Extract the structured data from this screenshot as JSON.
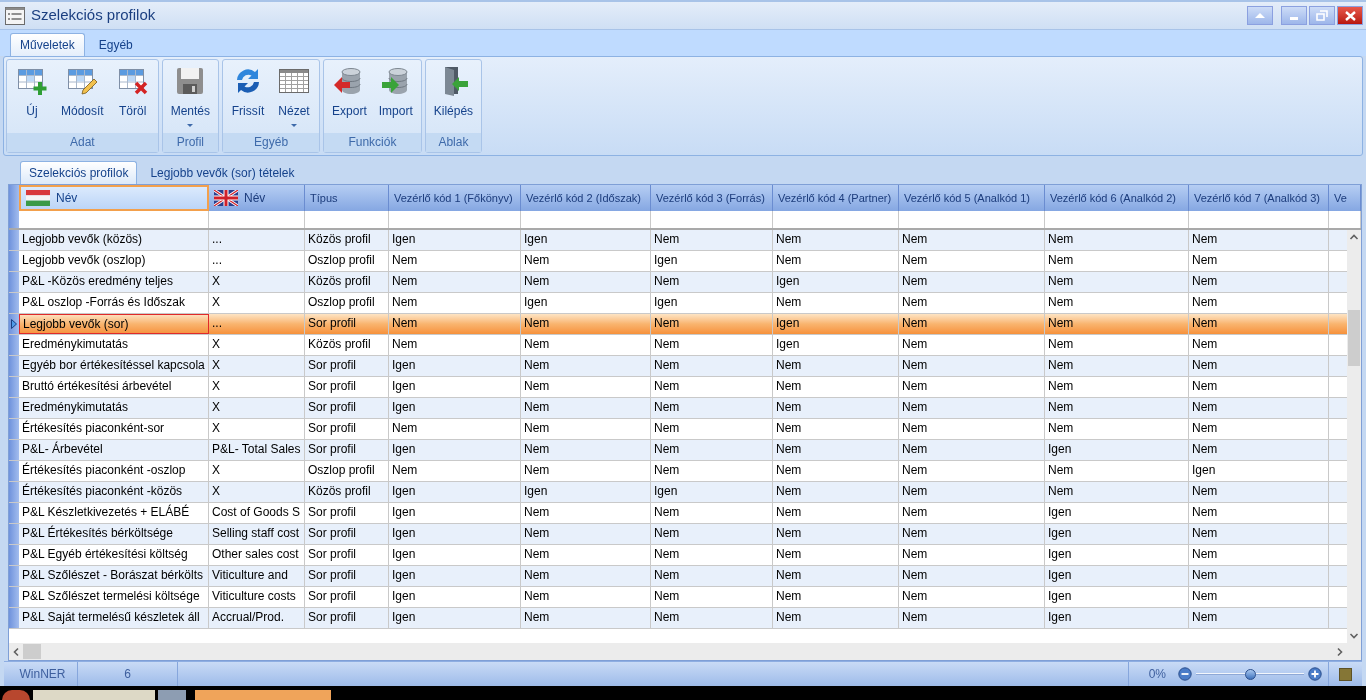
{
  "window": {
    "title": "Szelekciós profilok"
  },
  "ribbon": {
    "tabs": [
      {
        "label": "Műveletek",
        "selected": true
      },
      {
        "label": "Egyéb",
        "selected": false
      }
    ],
    "groups": [
      {
        "label": "Adat",
        "buttons": [
          {
            "label": "Új",
            "dropdown": false
          },
          {
            "label": "Módosít",
            "dropdown": false
          },
          {
            "label": "Töröl",
            "dropdown": false
          }
        ]
      },
      {
        "label": "Profil",
        "buttons": [
          {
            "label": "Mentés",
            "dropdown": true
          }
        ]
      },
      {
        "label": "Egyéb",
        "buttons": [
          {
            "label": "Frissít",
            "dropdown": false
          },
          {
            "label": "Nézet",
            "dropdown": true
          }
        ]
      },
      {
        "label": "Funkciók",
        "buttons": [
          {
            "label": "Export",
            "dropdown": false
          },
          {
            "label": "Import",
            "dropdown": false
          }
        ]
      },
      {
        "label": "Ablak",
        "buttons": [
          {
            "label": "Kilépés",
            "dropdown": false
          }
        ]
      }
    ]
  },
  "document_tabs": [
    {
      "label": "Szelekciós profilok",
      "selected": true
    },
    {
      "label": "Legjobb vevők (sor) tételek",
      "selected": false
    }
  ],
  "grid": {
    "columns": [
      {
        "label": "Név",
        "selected": true
      },
      {
        "label": "Név",
        "selected": false
      },
      {
        "label": "Típus",
        "selected": false
      },
      {
        "label": "Vezérlő kód 1 (Főkönyv)",
        "selected": false
      },
      {
        "label": "Vezérlő kód 2 (Időszak)",
        "selected": false
      },
      {
        "label": "Vezérlő kód 3 (Forrás)",
        "selected": false
      },
      {
        "label": "Vezérlő kód 4 (Partner)",
        "selected": false
      },
      {
        "label": "Vezérlő kód 5 (Analkód 1)",
        "selected": false
      },
      {
        "label": "Vezérlő kód 6 (Analkód 2)",
        "selected": false
      },
      {
        "label": "Vezérlő kód 7 (Analkód 3)",
        "selected": false
      },
      {
        "label": "Ve",
        "selected": false
      }
    ],
    "rows": [
      {
        "selected": false,
        "cells": [
          "Legjobb vevők (közös)",
          "...",
          "Közös profil",
          "Igen",
          "Igen",
          "Nem",
          "Nem",
          "Nem",
          "Nem",
          "Nem"
        ]
      },
      {
        "selected": false,
        "cells": [
          "Legjobb vevők (oszlop)",
          "...",
          "Oszlop profil",
          "Nem",
          "Nem",
          "Igen",
          "Nem",
          "Nem",
          "Nem",
          "Nem"
        ]
      },
      {
        "selected": false,
        "cells": [
          "P&L -Közös eredmény teljes",
          "X",
          "Közös profil",
          "Nem",
          "Nem",
          "Nem",
          "Igen",
          "Nem",
          "Nem",
          "Nem"
        ]
      },
      {
        "selected": false,
        "cells": [
          "P&L oszlop -Forrás és Időszak",
          "X",
          "Oszlop profil",
          "Nem",
          "Igen",
          "Igen",
          "Nem",
          "Nem",
          "Nem",
          "Nem"
        ]
      },
      {
        "selected": true,
        "cells": [
          "Legjobb vevők (sor)",
          "...",
          "Sor profil",
          "Nem",
          "Nem",
          "Nem",
          "Igen",
          "Nem",
          "Nem",
          "Nem"
        ]
      },
      {
        "selected": false,
        "cells": [
          "Eredménykimutatás",
          "X",
          "Közös profil",
          "Nem",
          "Nem",
          "Nem",
          "Igen",
          "Nem",
          "Nem",
          "Nem"
        ]
      },
      {
        "selected": false,
        "cells": [
          "Egyéb bor értékesítéssel kapcsola",
          "X",
          "Sor profil",
          "Igen",
          "Nem",
          "Nem",
          "Nem",
          "Nem",
          "Nem",
          "Nem"
        ]
      },
      {
        "selected": false,
        "cells": [
          "Bruttó értékesítési árbevétel",
          "X",
          "Sor profil",
          "Igen",
          "Nem",
          "Nem",
          "Nem",
          "Nem",
          "Nem",
          "Nem"
        ]
      },
      {
        "selected": false,
        "cells": [
          "Eredménykimutatás",
          "X",
          "Sor profil",
          "Igen",
          "Nem",
          "Nem",
          "Nem",
          "Nem",
          "Nem",
          "Nem"
        ]
      },
      {
        "selected": false,
        "cells": [
          "Értékesítés piaconként-sor",
          "X",
          "Sor profil",
          "Nem",
          "Nem",
          "Nem",
          "Nem",
          "Nem",
          "Nem",
          "Nem"
        ]
      },
      {
        "selected": false,
        "cells": [
          "P&L- Árbevétel",
          "P&L- Total Sales",
          "Sor profil",
          "Igen",
          "Nem",
          "Nem",
          "Nem",
          "Nem",
          "Igen",
          "Nem"
        ]
      },
      {
        "selected": false,
        "cells": [
          "Értékesítés piaconként -oszlop",
          "X",
          "Oszlop profil",
          "Nem",
          "Nem",
          "Nem",
          "Nem",
          "Nem",
          "Nem",
          "Igen"
        ]
      },
      {
        "selected": false,
        "cells": [
          "Értékesítés piaconként -közös",
          "X",
          "Közös profil",
          "Igen",
          "Igen",
          "Igen",
          "Nem",
          "Nem",
          "Nem",
          "Nem"
        ]
      },
      {
        "selected": false,
        "cells": [
          "P&L Készletkivezetés + ELÁBÉ",
          "Cost of Goods S",
          "Sor profil",
          "Igen",
          "Nem",
          "Nem",
          "Nem",
          "Nem",
          "Igen",
          "Nem"
        ]
      },
      {
        "selected": false,
        "cells": [
          "P&L Értékesítés bérköltsége",
          "Selling staff cost",
          "Sor profil",
          "Igen",
          "Nem",
          "Nem",
          "Nem",
          "Nem",
          "Igen",
          "Nem"
        ]
      },
      {
        "selected": false,
        "cells": [
          "P&L Egyéb értékesítési költség",
          "Other sales cost",
          "Sor profil",
          "Igen",
          "Nem",
          "Nem",
          "Nem",
          "Nem",
          "Igen",
          "Nem"
        ]
      },
      {
        "selected": false,
        "cells": [
          "P&L Szőlészet - Borászat bérkölts",
          "Viticulture and",
          "Sor profil",
          "Igen",
          "Nem",
          "Nem",
          "Nem",
          "Nem",
          "Igen",
          "Nem"
        ]
      },
      {
        "selected": false,
        "cells": [
          "P&L Szőlészet termelési költsége",
          "Viticulture costs",
          "Sor profil",
          "Igen",
          "Nem",
          "Nem",
          "Nem",
          "Nem",
          "Igen",
          "Nem"
        ]
      },
      {
        "selected": false,
        "cells": [
          "P&L Saját termelésű készletek áll",
          "Accrual/Prod.",
          "Sor profil",
          "Igen",
          "Nem",
          "Nem",
          "Nem",
          "Nem",
          "Igen",
          "Nem"
        ]
      }
    ]
  },
  "status_bar": {
    "app": "WinNER",
    "count": "6",
    "zoom_reading": "0%",
    "zoom_slider": {
      "level": 0.5
    }
  }
}
